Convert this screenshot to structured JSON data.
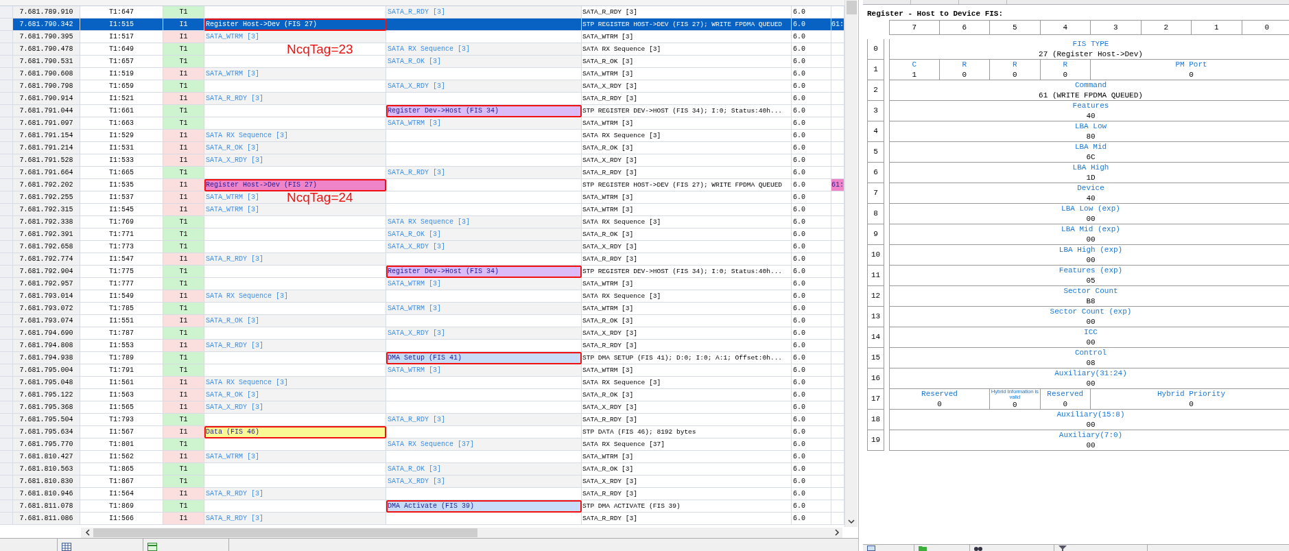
{
  "packets": [
    {
      "time": "7.681.789.910",
      "packet": "T1:647",
      "channel": "T1",
      "kind": "target",
      "cell": {
        "text": "SATA_R_RDY [3]"
      },
      "detail": "SATA_R_RDY [3]",
      "speed": "6.0",
      "selected": false
    },
    {
      "time": "7.681.790.342",
      "packet": "I1:515",
      "channel": "I1",
      "kind": "initiator",
      "cell": {
        "text": "Register Host->Dev (FIS 27)",
        "outlined": true
      },
      "detail": "STP REGISTER HOST->DEV (FIS 27); WRITE FPDMA QUEUED",
      "speed": "6.0",
      "column_9": {
        "text": "61:"
      },
      "selected": true
    },
    {
      "time": "7.681.790.395",
      "packet": "I1:517",
      "channel": "I1",
      "kind": "initiator",
      "cell": {
        "text": "SATA_WTRM [3]"
      },
      "detail": "SATA_WTRM [3]",
      "speed": "6.0",
      "selected": false
    },
    {
      "time": "7.681.790.478",
      "packet": "T1:649",
      "channel": "T1",
      "kind": "target",
      "cell": {
        "text": "SATA RX Sequence [3]"
      },
      "detail": "SATA RX Sequence [3]",
      "speed": "6.0",
      "note": "NcqTag=23",
      "selected": false
    },
    {
      "time": "7.681.790.531",
      "packet": "T1:657",
      "channel": "T1",
      "kind": "target",
      "cell": {
        "text": "SATA_R_OK [3]"
      },
      "detail": "SATA_R_OK [3]",
      "speed": "6.0",
      "selected": false
    },
    {
      "time": "7.681.790.608",
      "packet": "I1:519",
      "channel": "I1",
      "kind": "initiator",
      "cell": {
        "text": "SATA_WTRM [3]"
      },
      "detail": "SATA_WTRM [3]",
      "speed": "6.0",
      "selected": false
    },
    {
      "time": "7.681.790.798",
      "packet": "T1:659",
      "channel": "T1",
      "kind": "target",
      "cell": {
        "text": "SATA_X_RDY [3]"
      },
      "detail": "SATA_X_RDY [3]",
      "speed": "6.0",
      "selected": false
    },
    {
      "time": "7.681.790.914",
      "packet": "I1:521",
      "channel": "I1",
      "kind": "initiator",
      "cell": {
        "text": "SATA_R_RDY [3]"
      },
      "detail": "SATA_R_RDY [3]",
      "speed": "6.0",
      "selected": false
    },
    {
      "time": "7.681.791.044",
      "packet": "T1:661",
      "channel": "T1",
      "kind": "target",
      "cell": {
        "text": "Register Dev->Host (FIS 34)",
        "color": "#dcbcf8",
        "outlined": true
      },
      "detail": "STP REGISTER DEV->HOST (FIS 34); I:0; Status:40h...",
      "speed": "6.0",
      "selected": false
    },
    {
      "time": "7.681.791.097",
      "packet": "T1:663",
      "channel": "T1",
      "kind": "target",
      "cell": {
        "text": "SATA_WTRM [3]"
      },
      "detail": "SATA_WTRM [3]",
      "speed": "6.0",
      "selected": false
    },
    {
      "time": "7.681.791.154",
      "packet": "I1:529",
      "channel": "I1",
      "kind": "initiator",
      "cell": {
        "text": "SATA RX Sequence [3]"
      },
      "detail": "SATA RX Sequence [3]",
      "speed": "6.0",
      "selected": false
    },
    {
      "time": "7.681.791.214",
      "packet": "I1:531",
      "channel": "I1",
      "kind": "initiator",
      "cell": {
        "text": "SATA_R_OK [3]"
      },
      "detail": "SATA_R_OK [3]",
      "speed": "6.0",
      "selected": false
    },
    {
      "time": "7.681.791.528",
      "packet": "I1:533",
      "channel": "I1",
      "kind": "initiator",
      "cell": {
        "text": "SATA_X_RDY [3]"
      },
      "detail": "SATA_X_RDY [3]",
      "speed": "6.0",
      "selected": false
    },
    {
      "time": "7.681.791.664",
      "packet": "T1:665",
      "channel": "T1",
      "kind": "target",
      "cell": {
        "text": "SATA_R_RDY [3]"
      },
      "detail": "SATA_R_RDY [3]",
      "speed": "6.0",
      "selected": false
    },
    {
      "time": "7.681.792.202",
      "packet": "I1:535",
      "channel": "I1",
      "kind": "initiator",
      "cell": {
        "text": "Register Host->Dev (FIS 27)",
        "color": "#f084c8",
        "outlined": true
      },
      "detail": "STP REGISTER HOST->DEV (FIS 27); WRITE FPDMA QUEUED",
      "speed": "6.0",
      "column_9": {
        "text": "61:",
        "color": "#f084c8"
      },
      "selected": false
    },
    {
      "time": "7.681.792.255",
      "packet": "I1:537",
      "channel": "I1",
      "kind": "initiator",
      "cell": {
        "text": "SATA_WTRM [3]"
      },
      "detail": "SATA_WTRM [3]",
      "speed": "6.0",
      "note": "NcqTag=24",
      "selected": false
    },
    {
      "time": "7.681.792.315",
      "packet": "I1:545",
      "channel": "I1",
      "kind": "initiator",
      "cell": {
        "text": "SATA_WTRM [3]"
      },
      "detail": "SATA_WTRM [3]",
      "speed": "6.0",
      "selected": false
    },
    {
      "time": "7.681.792.338",
      "packet": "T1:769",
      "channel": "T1",
      "kind": "target",
      "cell": {
        "text": "SATA RX Sequence [3]"
      },
      "detail": "SATA RX Sequence [3]",
      "speed": "6.0",
      "selected": false
    },
    {
      "time": "7.681.792.391",
      "packet": "T1:771",
      "channel": "T1",
      "kind": "target",
      "cell": {
        "text": "SATA_R_OK [3]"
      },
      "detail": "SATA_R_OK [3]",
      "speed": "6.0",
      "selected": false
    },
    {
      "time": "7.681.792.658",
      "packet": "T1:773",
      "channel": "T1",
      "kind": "target",
      "cell": {
        "text": "SATA_X_RDY [3]"
      },
      "detail": "SATA_X_RDY [3]",
      "speed": "6.0",
      "selected": false
    },
    {
      "time": "7.681.792.774",
      "packet": "I1:547",
      "channel": "I1",
      "kind": "initiator",
      "cell": {
        "text": "SATA_R_RDY [3]"
      },
      "detail": "SATA_R_RDY [3]",
      "speed": "6.0",
      "selected": false
    },
    {
      "time": "7.681.792.904",
      "packet": "T1:775",
      "channel": "T1",
      "kind": "target",
      "cell": {
        "text": "Register Dev->Host (FIS 34)",
        "color": "#dcbcf8",
        "outlined": true
      },
      "detail": "STP REGISTER DEV->HOST (FIS 34); I:0; Status:40h...",
      "speed": "6.0",
      "selected": false
    },
    {
      "time": "7.681.792.957",
      "packet": "T1:777",
      "channel": "T1",
      "kind": "target",
      "cell": {
        "text": "SATA_WTRM [3]"
      },
      "detail": "SATA_WTRM [3]",
      "speed": "6.0",
      "selected": false
    },
    {
      "time": "7.681.793.014",
      "packet": "I1:549",
      "channel": "I1",
      "kind": "initiator",
      "cell": {
        "text": "SATA RX Sequence [3]"
      },
      "detail": "SATA RX Sequence [3]",
      "speed": "6.0",
      "selected": false
    },
    {
      "time": "7.681.793.072",
      "packet": "T1:785",
      "channel": "T1",
      "kind": "target",
      "cell": {
        "text": "SATA_WTRM [3]"
      },
      "detail": "SATA_WTRM [3]",
      "speed": "6.0",
      "selected": false
    },
    {
      "time": "7.681.793.074",
      "packet": "I1:551",
      "channel": "I1",
      "kind": "initiator",
      "cell": {
        "text": "SATA_R_OK [3]"
      },
      "detail": "SATA_R_OK [3]",
      "speed": "6.0",
      "selected": false
    },
    {
      "time": "7.681.794.690",
      "packet": "T1:787",
      "channel": "T1",
      "kind": "target",
      "cell": {
        "text": "SATA_X_RDY [3]"
      },
      "detail": "SATA_X_RDY [3]",
      "speed": "6.0",
      "selected": false
    },
    {
      "time": "7.681.794.808",
      "packet": "I1:553",
      "channel": "I1",
      "kind": "initiator",
      "cell": {
        "text": "SATA_R_RDY [3]"
      },
      "detail": "SATA_R_RDY [3]",
      "speed": "6.0",
      "selected": false
    },
    {
      "time": "7.681.794.938",
      "packet": "T1:789",
      "channel": "T1",
      "kind": "target",
      "cell": {
        "text": "DMA Setup (FIS 41)",
        "color": "#c8dcf8",
        "outlined": true
      },
      "detail": "STP DMA SETUP (FIS 41); D:0; I:0; A:1; Offset:0h...",
      "speed": "6.0",
      "selected": false
    },
    {
      "time": "7.681.795.004",
      "packet": "T1:791",
      "channel": "T1",
      "kind": "target",
      "cell": {
        "text": "SATA_WTRM [3]"
      },
      "detail": "SATA_WTRM [3]",
      "speed": "6.0",
      "selected": false
    },
    {
      "time": "7.681.795.048",
      "packet": "I1:561",
      "channel": "I1",
      "kind": "initiator",
      "cell": {
        "text": "SATA RX Sequence [3]"
      },
      "detail": "SATA RX Sequence [3]",
      "speed": "6.0",
      "selected": false
    },
    {
      "time": "7.681.795.122",
      "packet": "I1:563",
      "channel": "I1",
      "kind": "initiator",
      "cell": {
        "text": "SATA_R_OK [3]"
      },
      "detail": "SATA_R_OK [3]",
      "speed": "6.0",
      "selected": false
    },
    {
      "time": "7.681.795.368",
      "packet": "I1:565",
      "channel": "I1",
      "kind": "initiator",
      "cell": {
        "text": "SATA_X_RDY [3]"
      },
      "detail": "SATA_X_RDY [3]",
      "speed": "6.0",
      "selected": false
    },
    {
      "time": "7.681.795.504",
      "packet": "T1:793",
      "channel": "T1",
      "kind": "target",
      "cell": {
        "text": "SATA_R_RDY [3]"
      },
      "detail": "SATA_R_RDY [3]",
      "speed": "6.0",
      "selected": false
    },
    {
      "time": "7.681.795.634",
      "packet": "I1:567",
      "channel": "I1",
      "kind": "initiator",
      "cell": {
        "text": "Data (FIS 46)",
        "color": "#fafa94",
        "outlined": true
      },
      "detail": "STP DATA (FIS 46); 8192 bytes",
      "speed": "6.0",
      "selected": false
    },
    {
      "time": "7.681.795.770",
      "packet": "T1:801",
      "channel": "T1",
      "kind": "target",
      "cell": {
        "text": "SATA RX Sequence [37]"
      },
      "detail": "SATA RX Sequence [37]",
      "speed": "6.0",
      "selected": false
    },
    {
      "time": "7.681.810.427",
      "packet": "I1:562",
      "channel": "I1",
      "kind": "initiator",
      "cell": {
        "text": "SATA_WTRM [3]"
      },
      "detail": "SATA_WTRM [3]",
      "speed": "6.0",
      "selected": false
    },
    {
      "time": "7.681.810.563",
      "packet": "T1:865",
      "channel": "T1",
      "kind": "target",
      "cell": {
        "text": "SATA_R_OK [3]"
      },
      "detail": "SATA_R_OK [3]",
      "speed": "6.0",
      "selected": false
    },
    {
      "time": "7.681.810.830",
      "packet": "T1:867",
      "channel": "T1",
      "kind": "target",
      "cell": {
        "text": "SATA_X_RDY [3]"
      },
      "detail": "SATA_X_RDY [3]",
      "speed": "6.0",
      "selected": false
    },
    {
      "time": "7.681.810.946",
      "packet": "I1:564",
      "channel": "I1",
      "kind": "initiator",
      "cell": {
        "text": "SATA_R_RDY [3]"
      },
      "detail": "SATA_R_RDY [3]",
      "speed": "6.0",
      "selected": false
    },
    {
      "time": "7.681.811.078",
      "packet": "T1:869",
      "channel": "T1",
      "kind": "target",
      "cell": {
        "text": "DMA Activate (FIS 39)",
        "color": "#c8dcf8",
        "outlined": true
      },
      "detail": "STP DMA ACTIVATE (FIS 39)",
      "speed": "6.0",
      "selected": false
    },
    {
      "time": "7.681.811.086",
      "packet": "I1:566",
      "channel": "I1",
      "kind": "initiator",
      "cell": {
        "text": "SATA_R_RDY [3]"
      },
      "detail": "SATA_R_RDY [3]",
      "speed": "6.0",
      "selected": false
    }
  ],
  "fis_panel": {
    "title": "Register - Host to Device FIS:",
    "bit_headers": [
      "7",
      "6",
      "5",
      "4",
      "3",
      "2",
      "1",
      "0"
    ],
    "bytes": [
      {
        "index": "0",
        "fields": [
          {
            "label": "FIS TYPE",
            "value": "27 (Register Host->Dev)"
          }
        ]
      },
      {
        "index": "1",
        "fields": [
          {
            "label": "C",
            "value": "1"
          },
          {
            "label": "R",
            "value": "0"
          },
          {
            "label": "R",
            "value": "0"
          },
          {
            "label": "R",
            "value": "0"
          },
          {
            "label": "PM Port",
            "value": "0"
          }
        ]
      },
      {
        "index": "2",
        "fields": [
          {
            "label": "Command",
            "value": "61 (WRITE FPDMA QUEUED)"
          }
        ]
      },
      {
        "index": "3",
        "fields": [
          {
            "label": "Features",
            "value": "40"
          }
        ]
      },
      {
        "index": "4",
        "fields": [
          {
            "label": "LBA Low",
            "value": "80"
          }
        ]
      },
      {
        "index": "5",
        "fields": [
          {
            "label": "LBA Mid",
            "value": "6C"
          }
        ]
      },
      {
        "index": "6",
        "fields": [
          {
            "label": "LBA High",
            "value": "1D"
          }
        ]
      },
      {
        "index": "7",
        "fields": [
          {
            "label": "Device",
            "value": "40"
          }
        ]
      },
      {
        "index": "8",
        "fields": [
          {
            "label": "LBA Low (exp)",
            "value": "00"
          }
        ]
      },
      {
        "index": "9",
        "fields": [
          {
            "label": "LBA Mid (exp)",
            "value": "00"
          }
        ]
      },
      {
        "index": "10",
        "fields": [
          {
            "label": "LBA High (exp)",
            "value": "00"
          }
        ]
      },
      {
        "index": "11",
        "fields": [
          {
            "label": "Features (exp)",
            "value": "05"
          }
        ]
      },
      {
        "index": "12",
        "fields": [
          {
            "label": "Sector Count",
            "value": "B8"
          }
        ]
      },
      {
        "index": "13",
        "fields": [
          {
            "label": "Sector Count (exp)",
            "value": "00"
          }
        ]
      },
      {
        "index": "14",
        "fields": [
          {
            "label": "ICC",
            "value": "00"
          }
        ]
      },
      {
        "index": "15",
        "fields": [
          {
            "label": "Control",
            "value": "08"
          }
        ]
      },
      {
        "index": "16",
        "fields": [
          {
            "label": "Auxiliary(31:24)",
            "value": "00"
          }
        ]
      },
      {
        "index": "17",
        "fields": [
          {
            "label": "Reserved",
            "value": "0",
            "kind": "normal"
          },
          {
            "label": "Hybrid Information is valid",
            "value": "0",
            "kind": "fine"
          },
          {
            "label": "Reserved",
            "value": "0",
            "kind": "normal"
          },
          {
            "label": "Hybrid Priority",
            "value": "0",
            "kind": "normal"
          }
        ]
      },
      {
        "index": "18",
        "fields": [
          {
            "label": "Auxiliary(15:8)",
            "value": "00"
          }
        ]
      },
      {
        "index": "19",
        "fields": [
          {
            "label": "Auxiliary(7:0)",
            "value": "00"
          }
        ]
      }
    ]
  }
}
